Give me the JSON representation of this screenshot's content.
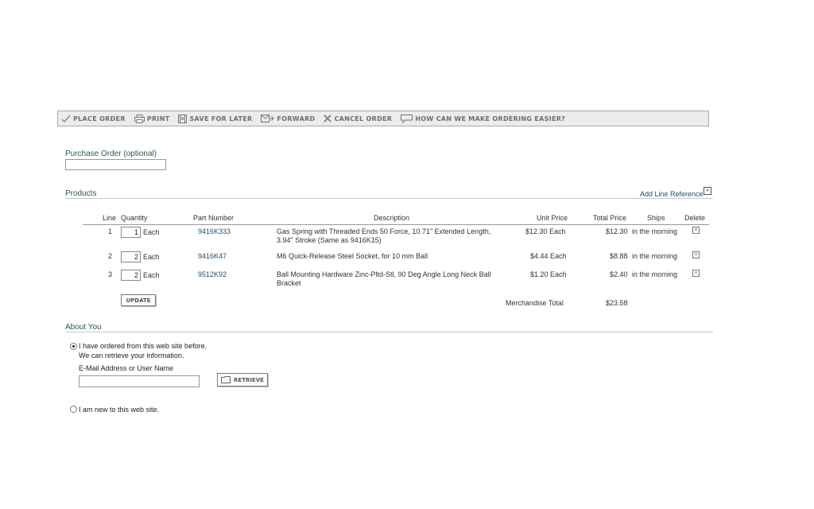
{
  "toolbar": {
    "place_order": "PLACE ORDER",
    "print": "PRINT",
    "save_for_later": "SAVE FOR LATER",
    "forward": "FORWARD",
    "cancel_order": "CANCEL ORDER",
    "feedback": "HOW CAN WE MAKE ORDERING EASIER?"
  },
  "purchase_order": {
    "label": "Purchase Order  (optional)",
    "value": ""
  },
  "products": {
    "heading": "Products",
    "add_line_reference": "Add Line Reference",
    "columns": {
      "line": "Line",
      "quantity": "Quantity",
      "part_number": "Part Number",
      "description": "Description",
      "unit_price": "Unit Price",
      "total_price": "Total Price",
      "ships": "Ships",
      "delete": "Delete"
    },
    "rows": [
      {
        "line": "1",
        "qty": "1",
        "unit": "Each",
        "part": "9416K333",
        "desc1": "Gas Spring with Threaded Ends 50 Force, 10.71\" Extended Length,",
        "desc2": "3.94\" Stroke (Same as 9416K15)",
        "unit_price": "$12.30 Each",
        "total": "$12.30",
        "ships": "in the morning"
      },
      {
        "line": "2",
        "qty": "2",
        "unit": "Each",
        "part": "9416K47",
        "desc1": "M6 Quick-Release Steel Socket, for 10 mm Ball",
        "desc2": "",
        "unit_price": "$4.44 Each",
        "total": "$8.88",
        "ships": "in the morning"
      },
      {
        "line": "3",
        "qty": "2",
        "unit": "Each",
        "part": "9512K92",
        "desc1": "Ball Mounting Hardware Zinc-Pltd-Stl, 90 Deg Angle Long Neck Ball",
        "desc2": "Bracket",
        "unit_price": "$1.20 Each",
        "total": "$2.40",
        "ships": "in the morning"
      }
    ],
    "update_label": "UPDATE",
    "merch_total_label": "Merchandise Total",
    "merch_total_value": "$23.58"
  },
  "about_you": {
    "heading": "About You",
    "returning_label": "I have ordered from this web site before.",
    "returning_sub": "We can retrieve your information.",
    "email_label": "E-Mail Address or User Name",
    "email_value": "",
    "retrieve_label": "RETRIEVE",
    "new_label": "I am new to this web site.",
    "selected": "returning"
  }
}
